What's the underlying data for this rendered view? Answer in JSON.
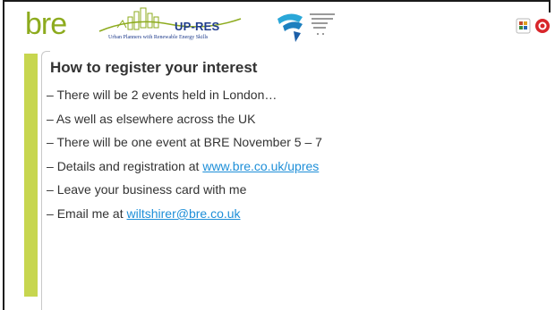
{
  "header": {
    "logos": {
      "bre_text": "bre",
      "upres_title": "UP-RES",
      "upres_subtitle": "Urban Planners with Renewable Energy Skills",
      "ei_logo_icon": "intelligent-energy-europe-logo",
      "partner_icons": [
        "chp-logo-icon",
        "red-seal-logo-icon"
      ]
    }
  },
  "slide": {
    "title": "How to register your interest",
    "bullets": [
      {
        "dash": "– ",
        "text": "There will be 2 events held in London…",
        "link": ""
      },
      {
        "dash": "– ",
        "text": "As well as elsewhere across the UK",
        "link": ""
      },
      {
        "dash": "– ",
        "text": "There will be one event at BRE November 5 – 7",
        "link": ""
      },
      {
        "dash": "– ",
        "text": "Details and registration at ",
        "link": "www.bre.co.uk/upres"
      },
      {
        "dash": "– ",
        "text": "Leave your business card with me",
        "link": ""
      },
      {
        "dash": "– ",
        "text": "Email me at ",
        "link": "wiltshirer@bre.co.uk"
      }
    ]
  },
  "colors": {
    "brand_green": "#8dab1e",
    "accent_bar": "#c7d64f",
    "link_blue": "#1e8fd8",
    "text": "#333333",
    "upres_blue": "#1f3c8c"
  }
}
